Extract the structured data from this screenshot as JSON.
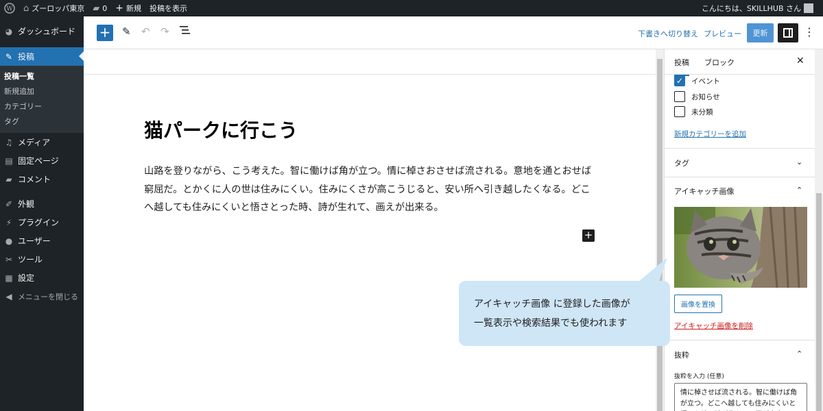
{
  "admin_bar": {
    "site_name": "ズーロッパ東京",
    "comments_count": "0",
    "new_label": "新規",
    "view_post_label": "投稿を表示",
    "greeting": "こんにちは、SKILLHUB さん"
  },
  "sidebar": {
    "items": [
      {
        "label": "ダッシュボード",
        "icon": "dashboard-icon"
      },
      {
        "label": "投稿",
        "icon": "pin-icon",
        "active": true
      },
      {
        "label": "メディア",
        "icon": "media-icon"
      },
      {
        "label": "固定ページ",
        "icon": "page-icon"
      },
      {
        "label": "コメント",
        "icon": "comment-icon"
      },
      {
        "label": "外観",
        "icon": "appearance-icon"
      },
      {
        "label": "プラグイン",
        "icon": "plugin-icon"
      },
      {
        "label": "ユーザー",
        "icon": "user-icon"
      },
      {
        "label": "ツール",
        "icon": "wrench-icon"
      },
      {
        "label": "設定",
        "icon": "settings-icon"
      }
    ],
    "submenu": [
      "投稿一覧",
      "新規追加",
      "カテゴリー",
      "タグ"
    ],
    "collapse_label": "メニューを閉じる"
  },
  "header": {
    "switch_to_draft": "下書きへ切り替え",
    "preview": "プレビュー",
    "update": "更新"
  },
  "post": {
    "title": "猫パークに行こう",
    "body": "山路を登りながら、こう考えた。智に働けば角が立つ。情に棹さおさせば流される。意地を通とおせば窮屈だ。とかくに人の世は住みにくい。住みにくさが高こうじると、安い所へ引き越したくなる。どこへ越しても住みにくいと悟さとった時、詩が生れて、画えが出来る。"
  },
  "panel": {
    "tabs": [
      "投稿",
      "ブロック"
    ],
    "categories": [
      {
        "label": "イベント",
        "checked": true
      },
      {
        "label": "お知らせ",
        "checked": false
      },
      {
        "label": "未分類",
        "checked": false
      }
    ],
    "add_category": "新規カテゴリーを追加",
    "tags_title": "タグ",
    "featured_title": "アイキャッチ画像",
    "replace_image": "画像を置換",
    "remove_featured": "アイキャッチ画像を削除",
    "excerpt_title": "抜粋",
    "excerpt_label": "抜粋を入力 (任意)",
    "excerpt_value": "情に棹させば流される。智に働けば角が立つ。どこへ越しても住みにくいと悟った時、詩が生れて、画が出来る。"
  },
  "callout": {
    "line1": "アイキャッチ画像 に登録した画像が",
    "line2": "一覧表示や検索結果でも使われます"
  },
  "colors": {
    "admin_dark": "#1d2327",
    "accent": "#2271b1",
    "callout_bg": "#cfe6f6",
    "danger": "#cc1818"
  }
}
